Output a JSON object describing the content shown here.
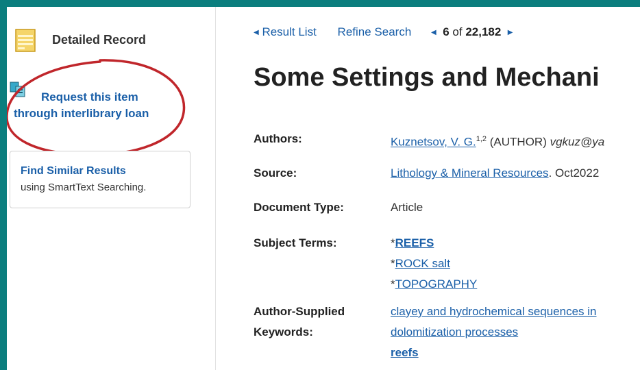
{
  "sidebar": {
    "detailed_record_label": "Detailed Record",
    "ill_line1": "Request this item",
    "ill_line2": "through interlibrary loan",
    "similar_title": "Find Similar Results",
    "similar_sub": "using SmartText Searching."
  },
  "nav": {
    "result_list": "Result List",
    "refine_search": "Refine Search",
    "current": "6",
    "of": "of",
    "total": "22,182"
  },
  "record": {
    "title": "Some Settings and Mechani",
    "fields": {
      "authors_label": "Authors:",
      "author_name": "Kuznetsov, V. G.",
      "author_sup": "1,2",
      "author_role": " (AUTHOR) ",
      "author_email": "vgkuz@ya",
      "source_label": "Source:",
      "source_journal": "Lithology & Mineral Resources",
      "source_rest": ". Oct2022",
      "doctype_label": "Document Type:",
      "doctype_value": "Article",
      "subject_label": "Subject Terms:",
      "subject_1": "REEFS",
      "subject_2": "ROCK salt",
      "subject_3": "TOPOGRAPHY",
      "asterisk": "*",
      "keywords_label_1": "Author-Supplied",
      "keywords_label_2": "Keywords:",
      "keyword_1": "clayey and hydrochemical sequences in",
      "keyword_2": "dolomitization processes",
      "keyword_3": "reefs"
    }
  },
  "colors": {
    "frame_border": "#0b7e7e",
    "link": "#1a5fa8",
    "annotation_circle": "#c0262b"
  }
}
